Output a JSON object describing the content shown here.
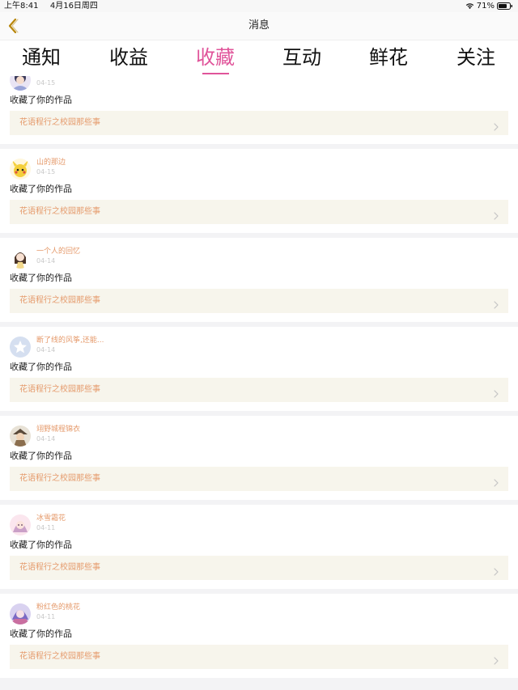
{
  "status_bar": {
    "time": "上午8:41",
    "date": "4月16日周四",
    "battery": "71%"
  },
  "nav": {
    "title": "消息"
  },
  "tabs": [
    {
      "label": "通知"
    },
    {
      "label": "收益"
    },
    {
      "label": "收藏"
    },
    {
      "label": "互动"
    },
    {
      "label": "鲜花"
    },
    {
      "label": "关注"
    }
  ],
  "active_tab_index": 2,
  "colors": {
    "accent": "#e0549a",
    "username": "#e59a6b",
    "work_bg": "#f7f5ec"
  },
  "items": [
    {
      "user": "剧的流浪倒映海之音",
      "date": "04-15",
      "action": "收藏了你的作品",
      "work": "花语程行之校园那些事",
      "avatar": "avatar-anime-icon"
    },
    {
      "user": "山的那边",
      "date": "04-15",
      "action": "收藏了你的作品",
      "work": "花语程行之校园那些事",
      "avatar": "avatar-pikachu-icon"
    },
    {
      "user": "一个人的回忆",
      "date": "04-14",
      "action": "收藏了你的作品",
      "work": "花语程行之校园那些事",
      "avatar": "avatar-girl-icon"
    },
    {
      "user": "断了线的风筝,还能...",
      "date": "04-14",
      "action": "收藏了你的作品",
      "work": "花语程行之校园那些事",
      "avatar": "avatar-default-star-icon"
    },
    {
      "user": "翊野城程锦衣",
      "date": "04-14",
      "action": "收藏了你的作品",
      "work": "花语程行之校园那些事",
      "avatar": "avatar-character-icon"
    },
    {
      "user": "冰雪霜花",
      "date": "04-11",
      "action": "收藏了你的作品",
      "work": "花语程行之校园那些事",
      "avatar": "avatar-pink-anime-icon"
    },
    {
      "user": "粉红色的桃花",
      "date": "04-11",
      "action": "收藏了你的作品",
      "work": "花语程行之校园那些事",
      "avatar": "avatar-purple-anime-icon"
    }
  ]
}
